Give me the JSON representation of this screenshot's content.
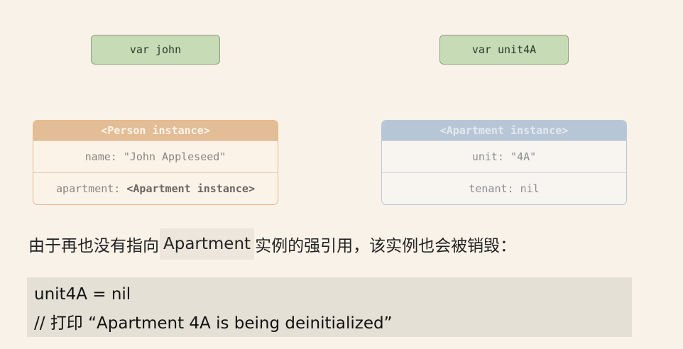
{
  "diagram": {
    "var_john": "var john",
    "var_unit4a": "var unit4A",
    "person": {
      "header": "<Person instance>",
      "name_prop": "name: \"John Appleseed\"",
      "apartment_label": "apartment: ",
      "apartment_value": "<Apartment instance>"
    },
    "apartment": {
      "header": "<Apartment instance>",
      "unit_prop": "unit: \"4A\"",
      "tenant_prop": "tenant: nil"
    }
  },
  "text": {
    "prefix": "由于再也没有指向",
    "highlight": "Apartment",
    "suffix": "实例的强引用，该实例也会被销毁："
  },
  "code": {
    "line1": "unit4A = nil",
    "line2": "// 打印 “Apartment 4A is being deinitialized”"
  }
}
